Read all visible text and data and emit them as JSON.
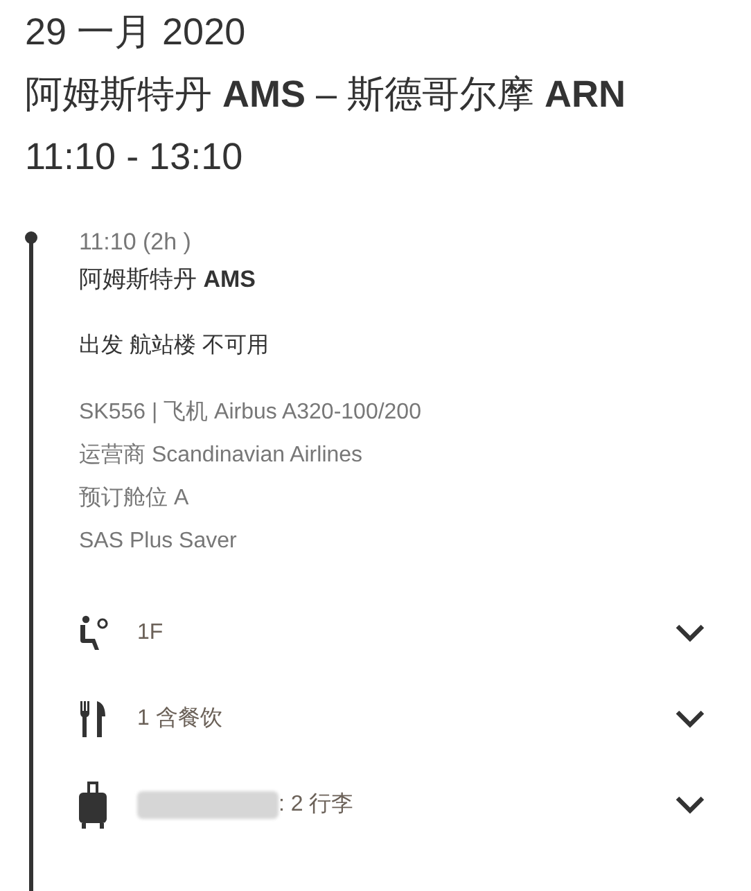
{
  "header": {
    "date": "29 一月 2020",
    "route": "阿姆斯特丹 **AMS** – 斯德哥尔摩 **ARN**",
    "times": "11:10 - 13:10"
  },
  "segment": {
    "time": "11:10 (2h )",
    "airport": "阿姆斯特丹 **AMS**",
    "terminal": "出发 航站楼 不可用",
    "details": [
      "SK556 | 飞机 Airbus A320-100/200",
      "运营商 Scandinavian Airlines",
      "预订舱位 A",
      "SAS Plus Saver"
    ]
  },
  "services": [
    {
      "kind": "seat",
      "label": "1F",
      "expanded": false,
      "redacted": false
    },
    {
      "kind": "meal",
      "label": "1 含餐饮",
      "expanded": false,
      "redacted": false
    },
    {
      "kind": "baggage",
      "label": ": 2 行李",
      "expanded": false,
      "redacted": true
    }
  ]
}
